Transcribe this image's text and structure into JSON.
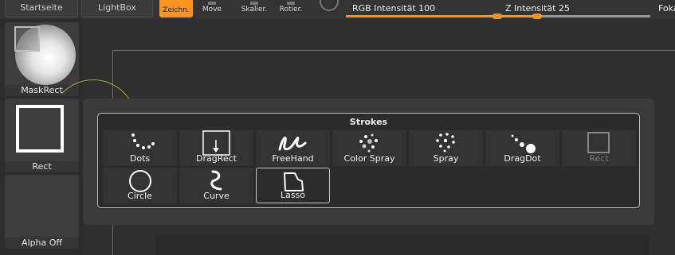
{
  "toolbar": {
    "startseite_label": "Startseite",
    "lightbox_label": "LightBox",
    "draw_label": "Zeichn.",
    "move_label": "Move",
    "scale_label": "Skalier.",
    "rotate_label": "Rotier.",
    "rgb_intensity_label": "RGB Intensität 100",
    "rgb_intensity_value": 100,
    "z_intensity_label": "Z Intensität 25",
    "z_intensity_value": 25,
    "focal_label": "Foka",
    "accent_color": "#f7931e"
  },
  "left_panel": {
    "brush_label": "MaskRect",
    "stroke_label": "Rect",
    "alpha_label": "Alpha Off"
  },
  "strokes_popup": {
    "title": "Strokes",
    "row1": [
      {
        "label": "Dots",
        "icon": "dots-icon"
      },
      {
        "label": "DragRect",
        "icon": "dragrect-icon"
      },
      {
        "label": "FreeHand",
        "icon": "freehand-icon"
      },
      {
        "label": "Color Spray",
        "icon": "color-spray-icon"
      },
      {
        "label": "Spray",
        "icon": "spray-icon"
      },
      {
        "label": "DragDot",
        "icon": "dragdot-icon"
      },
      {
        "label": "Rect",
        "icon": "rect-icon",
        "disabled": true
      }
    ],
    "row2": [
      {
        "label": "Circle",
        "icon": "circle-icon"
      },
      {
        "label": "Curve",
        "icon": "curve-icon"
      },
      {
        "label": "Lasso",
        "icon": "lasso-icon",
        "selected": true
      }
    ]
  }
}
